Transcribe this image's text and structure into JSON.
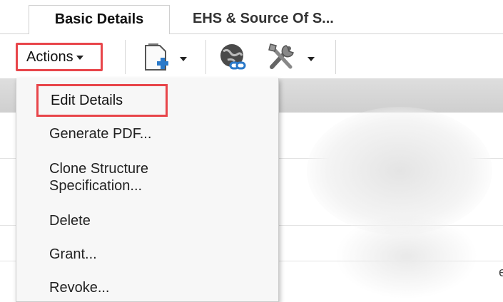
{
  "tabs": [
    {
      "label": "Basic Details",
      "active": true
    },
    {
      "label": "EHS & Source Of S...",
      "active": false
    }
  ],
  "toolbar": {
    "actions_label": "Actions",
    "icons": [
      "new-document-icon",
      "globe-link-icon",
      "tools-icon"
    ]
  },
  "menu": {
    "items": [
      {
        "label": "Edit Details",
        "highlighted": true
      },
      {
        "label": "Generate PDF..."
      },
      {
        "label_line1": "Clone Structure",
        "label_line2": "Specification..."
      },
      {
        "label": "Delete"
      },
      {
        "label": "Grant..."
      },
      {
        "label": "Revoke..."
      }
    ]
  },
  "edge_text": "e",
  "colors": {
    "highlight": "#e8454a",
    "menu_bg": "#f7f7f7",
    "icon_blue": "#2a79c9"
  }
}
